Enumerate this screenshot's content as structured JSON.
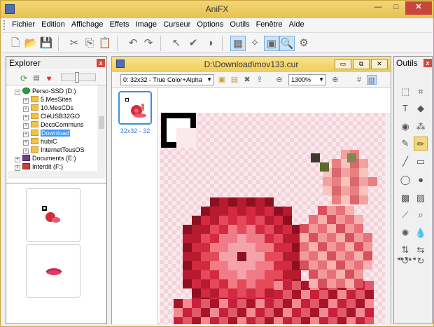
{
  "app": {
    "title": "AniFX"
  },
  "window_buttons": {
    "min": "—",
    "max": "□",
    "close": "✕"
  },
  "menu": [
    "Fichier",
    "Edition",
    "Affichage",
    "Effets",
    "Image",
    "Curseur",
    "Options",
    "Outils",
    "Fenêtre",
    "Aide"
  ],
  "toolbar": {
    "items": [
      {
        "name": "new-file-icon",
        "glyph": "🗋"
      },
      {
        "name": "open-folder-icon",
        "glyph": "📂"
      },
      {
        "name": "save-icon",
        "glyph": "💾"
      },
      {
        "name": "cut-icon",
        "glyph": "✂"
      },
      {
        "name": "copy-icon",
        "glyph": "⎘"
      },
      {
        "name": "paste-icon",
        "glyph": "📋"
      },
      {
        "name": "undo-icon",
        "glyph": "↶"
      },
      {
        "name": "redo-icon",
        "glyph": "↷"
      },
      {
        "name": "cursor-test-icon",
        "glyph": "↖"
      },
      {
        "name": "check-icon",
        "glyph": "✔"
      },
      {
        "name": "hotspot-icon",
        "glyph": "◑"
      },
      {
        "name": "grid-view-icon",
        "glyph": "▦"
      },
      {
        "name": "frog-icon",
        "glyph": "✧"
      },
      {
        "name": "frame-view-icon",
        "glyph": "▣"
      },
      {
        "name": "zoom-icon",
        "glyph": "🔍"
      },
      {
        "name": "tools-icon",
        "glyph": "⚙"
      }
    ]
  },
  "explorer": {
    "title": "Explorer",
    "close": "x",
    "tree": [
      {
        "label": "Perso-SSD (D:)",
        "level": 0,
        "expand": "−",
        "kind": "drive-ok"
      },
      {
        "label": "5.MesSites",
        "level": 1,
        "expand": "+",
        "kind": "folder"
      },
      {
        "label": "10.MesCDs",
        "level": 1,
        "expand": "+",
        "kind": "folder"
      },
      {
        "label": "CléUSB32GO",
        "level": 1,
        "expand": "+",
        "kind": "folder"
      },
      {
        "label": "DocsCommuns",
        "level": 1,
        "expand": "+",
        "kind": "folder"
      },
      {
        "label": "Download",
        "level": 1,
        "expand": "+",
        "kind": "folder",
        "selected": true
      },
      {
        "label": "hubiC",
        "level": 1,
        "expand": "+",
        "kind": "folder"
      },
      {
        "label": "InternetTousOS",
        "level": 1,
        "expand": "+",
        "kind": "folder"
      },
      {
        "label": "Documents (E:)",
        "level": 0,
        "expand": "+",
        "kind": "drive-book"
      },
      {
        "label": "Interdit (F:)",
        "level": 0,
        "expand": "+",
        "kind": "drive-red"
      }
    ]
  },
  "document": {
    "title": "D:\\Download\\mov133.cur",
    "format_select": "0: 32x32 - True Color+Alpha",
    "zoom_select": "1300%",
    "frame_label": "32x32 - 32",
    "buttons": {
      "min": "▭",
      "restore": "⧉",
      "close": "✕"
    }
  },
  "outils": {
    "title": "Outils",
    "close": "x"
  },
  "colors": {
    "accent": "#3399ff",
    "title_bar": "#f0cd56",
    "close_red": "#d9463c"
  }
}
